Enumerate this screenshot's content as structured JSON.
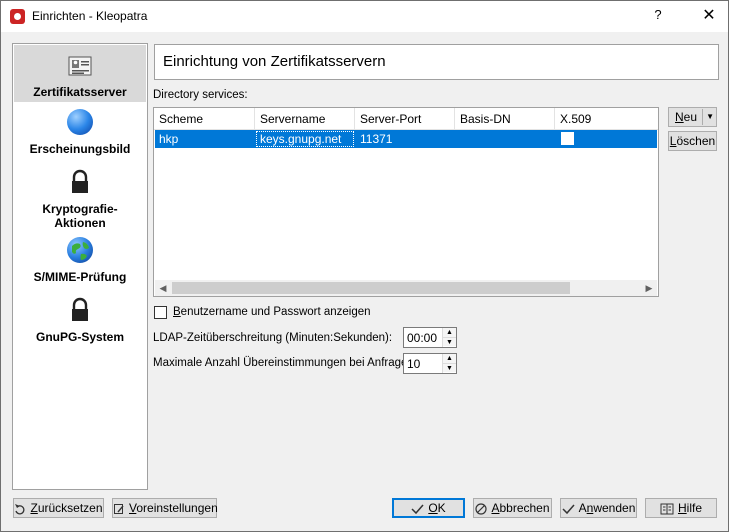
{
  "window": {
    "title": "Einrichten - Kleopatra",
    "help_glyph": "?",
    "close_glyph": "✕"
  },
  "sidebar": {
    "items": [
      {
        "label": "Zertifikatsserver",
        "icon": "certificate-server-icon",
        "selected": true
      },
      {
        "label": "Erscheinungsbild",
        "icon": "globe-blue-icon"
      },
      {
        "label_line1": "Kryptografie-",
        "label_line2": "Aktionen",
        "icon": "lock-icon"
      },
      {
        "label": "S/MIME-Prüfung",
        "icon": "globe-earth-icon"
      },
      {
        "label": "GnuPG-System",
        "icon": "lock-icon"
      }
    ]
  },
  "page": {
    "title": "Einrichtung von Zertifikatsservern",
    "directory_label": "Directory services:"
  },
  "table": {
    "columns": [
      "Scheme",
      "Servername",
      "Server-Port",
      "Basis-DN",
      "X.509"
    ],
    "rows": [
      {
        "scheme": "hkp",
        "servername": "keys.gnupg.net",
        "port": "11371",
        "basedn": "",
        "x509": false
      }
    ]
  },
  "side_buttons": {
    "new_label": "Neu",
    "delete_label": "Löschen"
  },
  "options": {
    "show_credentials_label": "Benutzername und Passwort anzeigen",
    "show_credentials_checked": false,
    "ldap_timeout_label": "LDAP-Zeitüberschreitung (Minuten:Sekunden):",
    "ldap_timeout_value": "00:00",
    "max_matches_label": "Maximale Anzahl Übereinstimmungen bei Anfragen:",
    "max_matches_value": "10"
  },
  "footer": {
    "reset_label": "Zurücksetzen",
    "defaults_label": "Voreinstellungen",
    "ok_label": "OK",
    "cancel_label": "Abbrechen",
    "apply_label": "Anwenden",
    "help_label": "Hilfe"
  },
  "colors": {
    "selection": "#0078d7",
    "window_bg": "#f0f0f0"
  }
}
